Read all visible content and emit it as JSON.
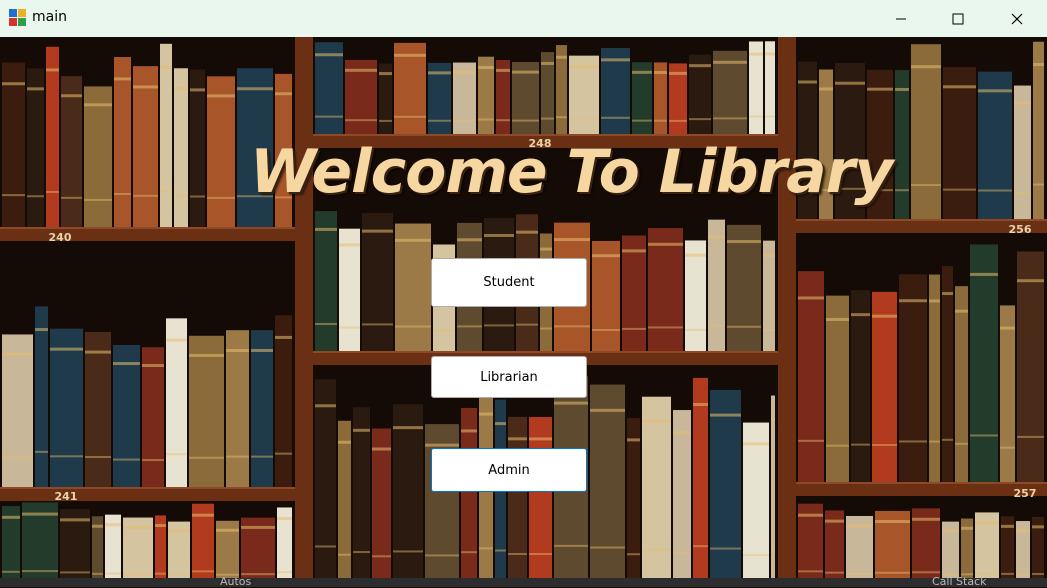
{
  "window": {
    "title": "main",
    "controls": [
      "minimize-icon",
      "maximize-icon",
      "close-icon"
    ]
  },
  "main": {
    "heading": "Welcome To Library",
    "buttons": {
      "student": "Student",
      "librarian": "Librarian",
      "admin": "Admin"
    }
  },
  "shelf_labels": [
    "240",
    "248",
    "256",
    "241",
    "257"
  ],
  "background_ide": {
    "autos": "Autos",
    "call_stack": "Call Stack"
  },
  "colors": {
    "titlebar": "#e9f7ee",
    "heading": "#f6d7a2",
    "shelf_wood": "#6b2f14",
    "button_focus": "#0078d7"
  }
}
